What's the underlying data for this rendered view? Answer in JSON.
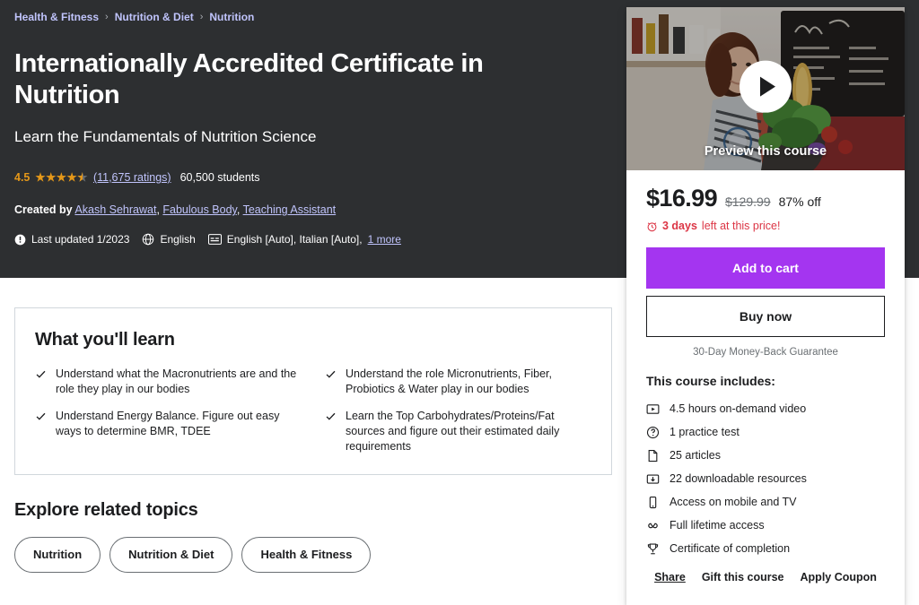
{
  "breadcrumb": [
    {
      "label": "Health & Fitness"
    },
    {
      "label": "Nutrition & Diet"
    },
    {
      "label": "Nutrition"
    }
  ],
  "breadcrumb_separator": "›",
  "hero": {
    "title": "Internationally Accredited Certificate in Nutrition",
    "headline": "Learn the Fundamentals of Nutrition Science",
    "rating_value": "4.5",
    "ratings_count_label": "(11,675 ratings)",
    "students_label": "60,500 students",
    "created_by_label": "Created by",
    "authors": [
      "Akash Sehrawat",
      "Fabulous Body",
      "Teaching Assistant"
    ],
    "last_updated": "Last updated 1/2023",
    "language": "English",
    "captions": "English [Auto], Italian [Auto],",
    "captions_more": "1 more"
  },
  "learn": {
    "title": "What you'll learn",
    "items": [
      "Understand what the Macronutrients are and the role they play in our bodies",
      "Understand the role Micronutrients, Fiber, Probiotics & Water play in our bodies",
      "Understand Energy Balance. Figure out easy ways to determine BMR, TDEE",
      "Learn the Top Carbohydrates/Proteins/Fat sources and figure out their estimated daily requirements"
    ]
  },
  "topics": {
    "title": "Explore related topics",
    "chips": [
      "Nutrition",
      "Nutrition & Diet",
      "Health & Fitness"
    ]
  },
  "sidebar": {
    "preview_label": "Preview this course",
    "price_current": "$16.99",
    "price_original": "$129.99",
    "price_discount": "87% off",
    "urgency_bold": "3 days",
    "urgency_rest": "left at this price!",
    "add_to_cart_label": "Add to cart",
    "buy_now_label": "Buy now",
    "guarantee": "30-Day Money-Back Guarantee",
    "includes_title": "This course includes:",
    "includes": [
      {
        "icon": "video-icon",
        "label": "4.5 hours on-demand video"
      },
      {
        "icon": "question-circle-icon",
        "label": "1 practice test"
      },
      {
        "icon": "document-icon",
        "label": "25 articles"
      },
      {
        "icon": "download-icon",
        "label": "22 downloadable resources"
      },
      {
        "icon": "mobile-icon",
        "label": "Access on mobile and TV"
      },
      {
        "icon": "infinity-icon",
        "label": "Full lifetime access"
      },
      {
        "icon": "trophy-icon",
        "label": "Certificate of completion"
      }
    ],
    "links": [
      "Share",
      "Gift this course",
      "Apply Coupon"
    ]
  },
  "colors": {
    "hero_bg": "#2d2f31",
    "brand_purple": "#a435f0",
    "link_purple": "#c0c4fc",
    "star_gold": "#e59819",
    "urgency_red": "#dc3545"
  }
}
